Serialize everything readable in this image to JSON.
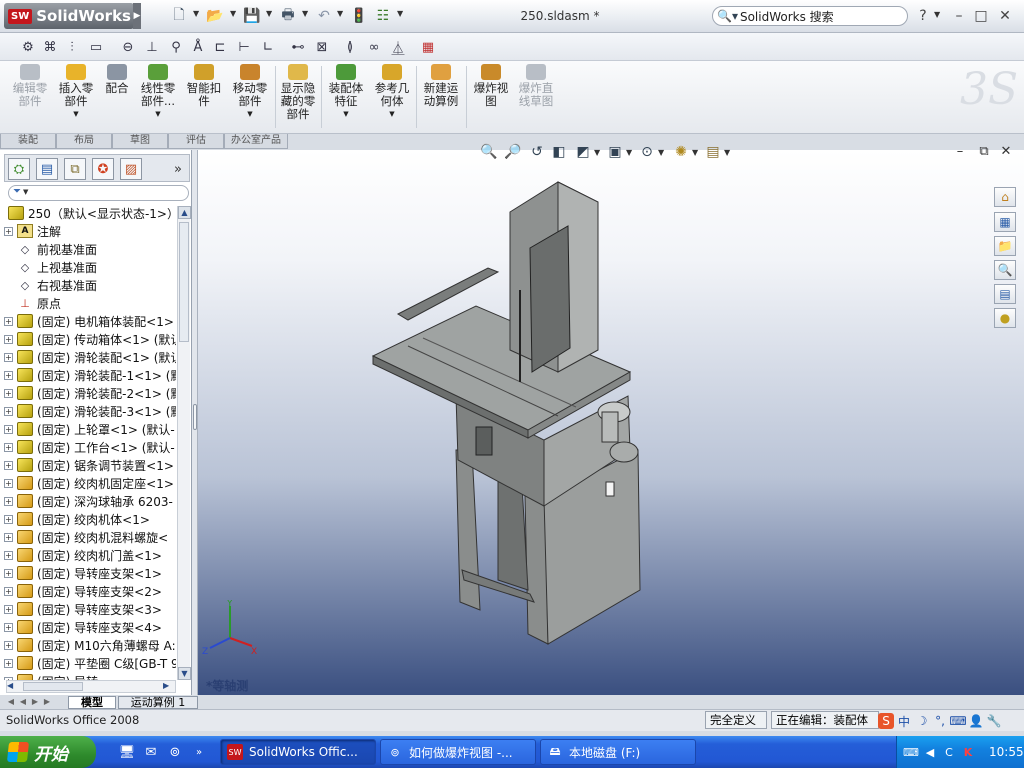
{
  "app": {
    "brand": "SolidWorks",
    "doc_title": "250.sldasm *"
  },
  "search": {
    "placeholder": "SolidWorks 搜索"
  },
  "window_controls": {
    "help": "?",
    "minimize": "–",
    "restore": "□",
    "close": "✕"
  },
  "command_manager": {
    "items": [
      {
        "label": "编辑零\n部件",
        "disabled": true,
        "color": "#b8bec6"
      },
      {
        "label": "插入零\n部件",
        "disabled": false,
        "color": "#e8b32a"
      },
      {
        "label": "配合",
        "disabled": false,
        "color": "#8b95a3"
      },
      {
        "label": "线性零\n部件...",
        "disabled": false,
        "color": "#5a9f3a"
      },
      {
        "label": "智能扣\n件",
        "disabled": false,
        "color": "#d0a02a"
      },
      {
        "label": "移动零\n部件",
        "disabled": false,
        "color": "#c9842c"
      },
      {
        "label": "显示隐\n藏的零\n部件",
        "disabled": false,
        "color": "#e0b84a"
      },
      {
        "label": "装配体\n特征",
        "disabled": false,
        "color": "#4d9a3a"
      },
      {
        "label": "参考几\n何体",
        "disabled": false,
        "color": "#d8a62a"
      },
      {
        "label": "新建运\n动算例",
        "disabled": false,
        "color": "#e0a040"
      },
      {
        "label": "爆炸视\n图",
        "disabled": false,
        "color": "#c98a2a"
      },
      {
        "label": "爆炸直\n线草图",
        "disabled": true,
        "color": "#b8bec6"
      }
    ],
    "tabs": [
      "装配",
      "布局",
      "草图",
      "评估",
      "办公室产品"
    ],
    "active_tab": "装配"
  },
  "filter": {
    "icon": "▼"
  },
  "tree": {
    "root": "250（默认<显示状态-1>）",
    "rows": [
      {
        "label": "注解",
        "icon": "annotation-icon",
        "expandable": true
      },
      {
        "label": "前视基准面",
        "icon": "plane-icon",
        "expandable": false
      },
      {
        "label": "上视基准面",
        "icon": "plane-icon",
        "expandable": false
      },
      {
        "label": "右视基准面",
        "icon": "plane-icon",
        "expandable": false
      },
      {
        "label": "原点",
        "icon": "origin-icon",
        "expandable": false
      },
      {
        "label": "(固定) 电机箱体装配<1>",
        "icon": "assembly-icon",
        "expandable": true
      },
      {
        "label": "(固定) 传动箱体<1> (默认",
        "icon": "assembly-icon",
        "expandable": true
      },
      {
        "label": "(固定) 滑轮装配<1> (默认",
        "icon": "assembly-icon",
        "expandable": true
      },
      {
        "label": "(固定) 滑轮装配-1<1> (默",
        "icon": "assembly-icon",
        "expandable": true
      },
      {
        "label": "(固定) 滑轮装配-2<1> (默",
        "icon": "assembly-icon",
        "expandable": true
      },
      {
        "label": "(固定) 滑轮装配-3<1> (默",
        "icon": "assembly-icon",
        "expandable": true
      },
      {
        "label": "(固定) 上轮罩<1> (默认-",
        "icon": "assembly-icon",
        "expandable": true
      },
      {
        "label": "(固定) 工作台<1> (默认-",
        "icon": "assembly-icon",
        "expandable": true
      },
      {
        "label": "(固定) 锯条调节装置<1>",
        "icon": "assembly-icon",
        "expandable": true
      },
      {
        "label": "(固定) 绞肉机固定座<1>",
        "icon": "part-icon",
        "expandable": true
      },
      {
        "label": "(固定) 深沟球轴承 6203-",
        "icon": "part-icon",
        "expandable": true
      },
      {
        "label": "(固定) 绞肉机体<1>",
        "icon": "part-icon",
        "expandable": true
      },
      {
        "label": "(固定) 绞肉机混料螺旋<",
        "icon": "part-icon",
        "expandable": true
      },
      {
        "label": "(固定) 绞肉机门盖<1>",
        "icon": "part-icon",
        "expandable": true
      },
      {
        "label": "(固定) 导转座支架<1>",
        "icon": "part-icon",
        "expandable": true
      },
      {
        "label": "(固定) 导转座支架<2>",
        "icon": "part-icon",
        "expandable": true
      },
      {
        "label": "(固定) 导转座支架<3>",
        "icon": "part-icon",
        "expandable": true
      },
      {
        "label": "(固定) 导转座支架<4>",
        "icon": "part-icon",
        "expandable": true
      },
      {
        "label": "(固定) M10六角薄螺母 A:",
        "icon": "part-icon",
        "expandable": true
      },
      {
        "label": "(固定) 平垫圈 C级[GB-T 9",
        "icon": "part-icon",
        "expandable": true
      },
      {
        "label": "(固定) 导转...",
        "icon": "part-icon",
        "expandable": true
      }
    ]
  },
  "bottom_tabs": {
    "model": "模型",
    "motion": "运动算例 1"
  },
  "viewport": {
    "view_name": "*等轴测"
  },
  "status": {
    "left": "SolidWorks Office 2008",
    "definition": "完全定义",
    "editing": "正在编辑：装配体"
  },
  "ime": {
    "items": [
      "S",
      "中",
      "☽",
      "°,",
      "⌨",
      "👤",
      "🔧"
    ]
  },
  "taskbar": {
    "start": "开始",
    "buttons": [
      {
        "label": "SolidWorks Offic...",
        "active": true
      },
      {
        "label": "如何做爆炸视图 -...",
        "active": false
      },
      {
        "label": "本地磁盘 (F:)",
        "active": false
      }
    ],
    "clock": "10:55"
  }
}
